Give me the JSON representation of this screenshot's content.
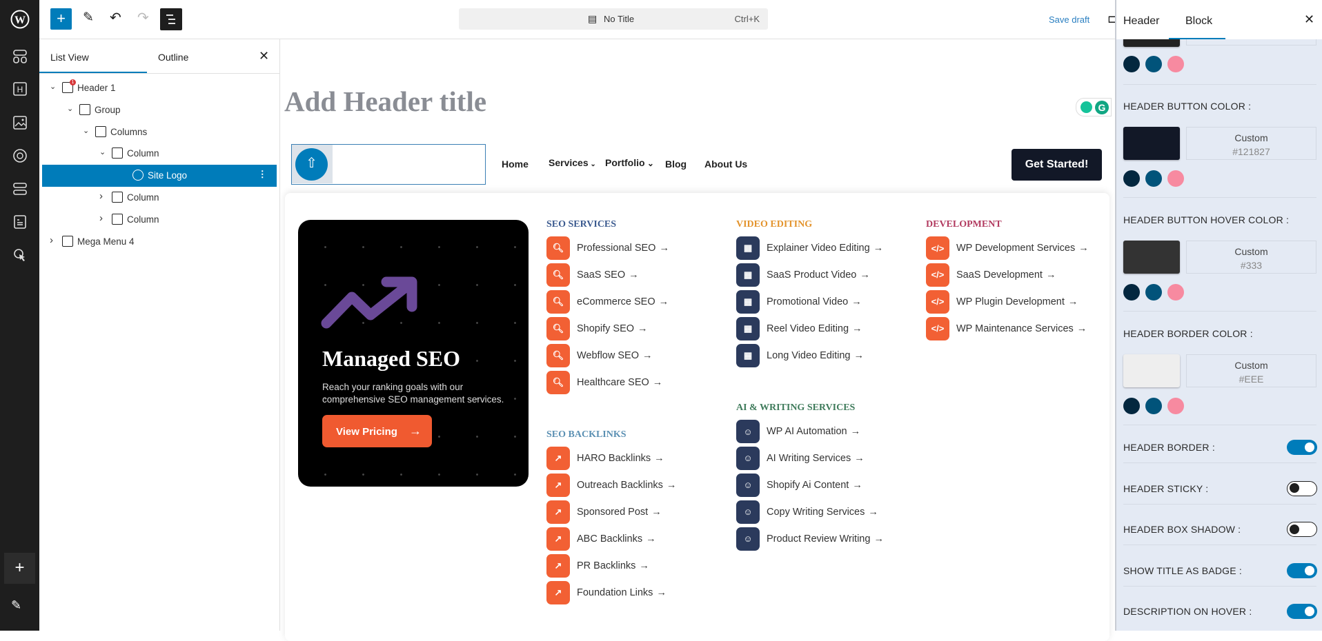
{
  "toolbar": {
    "document_title": "No Title",
    "shortcut": "Ctrl+K",
    "save_draft": "Save draft"
  },
  "list_view": {
    "tabs": [
      "List View",
      "Outline"
    ],
    "tree": [
      {
        "label": "Header 1",
        "level": 0,
        "expanded": true,
        "icon": "header-icon",
        "badge": "1"
      },
      {
        "label": "Group",
        "level": 1,
        "expanded": true,
        "icon": "group-icon"
      },
      {
        "label": "Columns",
        "level": 2,
        "expanded": true,
        "icon": "columns-icon"
      },
      {
        "label": "Column",
        "level": 3,
        "expanded": true,
        "icon": "column-icon"
      },
      {
        "label": "Site Logo",
        "level": 4,
        "selected": true,
        "icon": "site-logo-icon"
      },
      {
        "label": "Column",
        "level": 3,
        "expanded": false,
        "icon": "column-icon"
      },
      {
        "label": "Column",
        "level": 3,
        "expanded": false,
        "icon": "column-icon"
      },
      {
        "label": "Mega Menu 4",
        "level": 0,
        "expanded": false,
        "icon": "mega-menu-icon"
      }
    ]
  },
  "canvas": {
    "title_placeholder": "Add Header title",
    "nav": [
      "Home",
      "Services",
      "Portfolio",
      "Blog",
      "About Us"
    ],
    "cta": "Get Started!",
    "card": {
      "title": "Managed SEO",
      "description_line1": "Reach your ranking goals with our",
      "description_line2": "comprehensive SEO management services.",
      "button": "View Pricing"
    },
    "columns": [
      {
        "heading": "SEO SERVICES",
        "color": "#3b5a8f",
        "icon": "seo-search-icon",
        "icon_bg": "#f26034",
        "items": [
          "Professional SEO",
          "SaaS SEO",
          "eCommerce SEO",
          "Shopify SEO",
          "Webflow SEO",
          "Healthcare SEO"
        ]
      },
      {
        "heading": "SEO BACKLINKS",
        "color": "#5b90b3",
        "icon": "external-link-icon",
        "icon_bg": "#f26034",
        "items": [
          "HARO Backlinks",
          "Outreach Backlinks",
          "Sponsored Post",
          "ABC Backlinks",
          "PR Backlinks",
          "Foundation Links"
        ]
      },
      {
        "heading": "VIDEO EDITING",
        "color": "#e3932c",
        "icon": "film-icon",
        "icon_bg": "#2b3a5c",
        "items": [
          "Explainer Video Editing",
          "SaaS Product Video",
          "Promotional Video",
          "Reel Video Editing",
          "Long Video Editing"
        ]
      },
      {
        "heading": "AI & WRITING SERVICES",
        "color": "#3f7b5b",
        "icon": "robot-icon",
        "icon_bg": "#2b3a5c",
        "items": [
          "WP AI Automation",
          "AI Writing Services",
          "Shopify Ai Content",
          "Copy Writing Services",
          "Product Review Writing"
        ]
      },
      {
        "heading": "DEVELOPMENT",
        "color": "#b23b60",
        "icon": "code-icon",
        "icon_bg": "#f26034",
        "items": [
          "WP Development Services",
          "SaaS Development",
          "WP Plugin Development",
          "WP Maintenance Services"
        ]
      }
    ]
  },
  "settings": {
    "tabs": [
      "Header",
      "Block"
    ],
    "active_tab": "Block",
    "presets": [
      "#03273f",
      "#01537a",
      "#f78aa0"
    ],
    "colors": [
      {
        "label": "HEADER BUTTON COLOR :",
        "mode": "Custom",
        "value": "#121827"
      },
      {
        "label": "HEADER BUTTON HOVER COLOR :",
        "mode": "Custom",
        "value": "#333"
      },
      {
        "label": "HEADER BORDER COLOR :",
        "mode": "Custom",
        "value": "#EEE"
      }
    ],
    "toggles": [
      {
        "label": "HEADER BORDER :",
        "on": true
      },
      {
        "label": "HEADER STICKY :",
        "on": false
      },
      {
        "label": "HEADER BOX SHADOW :",
        "on": false
      },
      {
        "label": "SHOW TITLE AS BADGE :",
        "on": true
      },
      {
        "label": "DESCRIPTION ON HOVER :",
        "on": true
      }
    ]
  }
}
